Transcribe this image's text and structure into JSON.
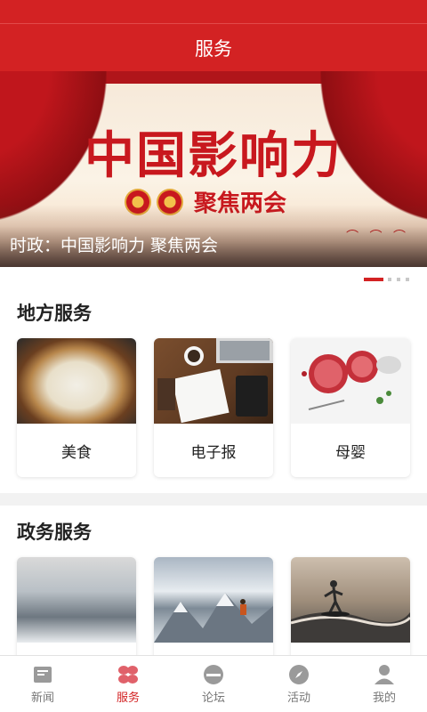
{
  "app": {
    "title": "服务"
  },
  "banner": {
    "headline": "中国影响力",
    "sub": "聚焦两会",
    "caption": "时政：中国影响力 聚焦两会",
    "slides": 4,
    "active_slide": 0
  },
  "local_services": {
    "title": "地方服务",
    "items": [
      {
        "label": "美食"
      },
      {
        "label": "电子报"
      },
      {
        "label": "母婴"
      }
    ]
  },
  "gov_services": {
    "title": "政务服务",
    "items": [
      {
        "label": ""
      },
      {
        "label": ""
      },
      {
        "label": ""
      }
    ]
  },
  "tabbar": {
    "items": [
      {
        "label": "新闻",
        "icon": "news-icon"
      },
      {
        "label": "服务",
        "icon": "service-icon"
      },
      {
        "label": "论坛",
        "icon": "forum-icon"
      },
      {
        "label": "活动",
        "icon": "compass-icon"
      },
      {
        "label": "我的",
        "icon": "user-icon"
      }
    ],
    "active": 1
  },
  "colors": {
    "brand": "#d32223",
    "inactive": "#9a9a9a"
  }
}
